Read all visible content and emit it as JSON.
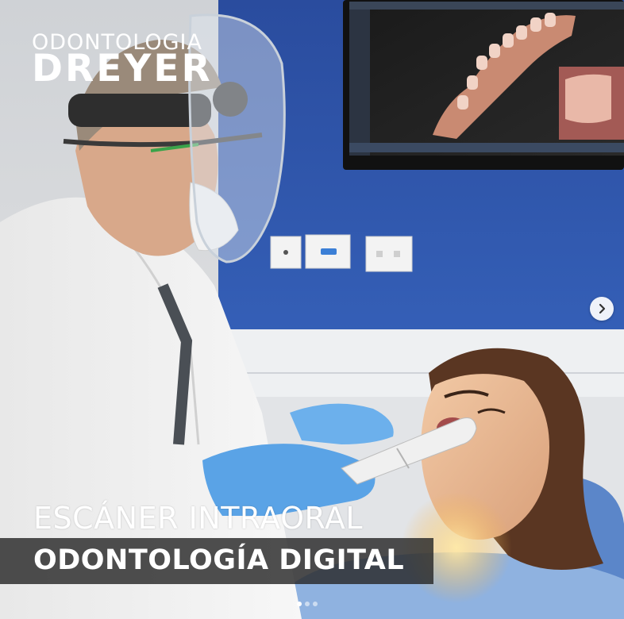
{
  "brand": {
    "line1": "ODONTOLOGIA",
    "line2": "DREYER"
  },
  "caption": {
    "line1": "ESCÁNER INTRAORAL",
    "line2": "ODONTOLOGÍA DIGITAL"
  },
  "carousel": {
    "next_icon": "chevron-right-icon",
    "slide_count": 3,
    "active_index": 0
  },
  "colors": {
    "wall_blue": "#2f54a8",
    "glove_blue": "#5aa3e6",
    "caption_bar": "#282828"
  }
}
